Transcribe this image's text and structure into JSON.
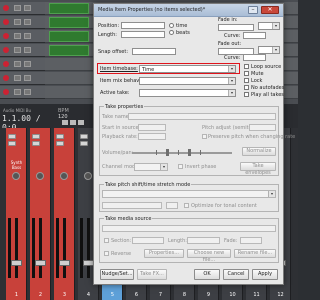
{
  "daw": {
    "transport_time": "1.1.00 / 0:0",
    "transport_label": "Audio MIDI Bu",
    "bpm_label": "BPM",
    "bpm_value": "120",
    "track_name": "Synth Bass",
    "strip_numbers": [
      "1",
      "2",
      "3",
      "4",
      "5",
      "6",
      "7",
      "8",
      "9",
      "10",
      "11",
      "12"
    ],
    "strip_colors": [
      "#c8413a",
      "#c8413a",
      "#c8413a",
      "#3d3f44",
      "#5ea0d8",
      "#3d3f44",
      "#3d3f44",
      "#3d3f44",
      "#3d3f44",
      "#3d3f44",
      "#3d3f44",
      "#3d3f44"
    ]
  },
  "dialog": {
    "title": "Media Item Properties (no items selected)*",
    "position_label": "Position:",
    "length_label": "Length:",
    "snap_offset_label": "Snap offset:",
    "time_base_beats": "beats",
    "time_base_time": "time",
    "fade_in_label": "Fade in:",
    "fade_out_label": "Fade out:",
    "curve_label": "Curve:",
    "item_timebase_label": "Item timebase:",
    "item_timebase_value": "Time",
    "item_mix_label": "Item mix behavior:",
    "active_take_label": "Active take:",
    "loop_source": "Loop source",
    "mute": "Mute",
    "lock": "Lock",
    "no_autofades": "No autofades",
    "play_all_takes": "Play all takes",
    "take_properties_title": "Take properties",
    "take_name_label": "Take name:",
    "start_in_source_label": "Start in source:",
    "playback_rate_label": "Playback rate:",
    "pitch_adjust_label": "Pitch adjust (semitones):",
    "preserve_pitch_label": "Preserve pitch when changing rate",
    "volume_pan_label": "Volume/pan:",
    "normalize_btn": "Normalize",
    "channel_mode_label": "Channel mode:",
    "invert_phase_label": "Invert phase",
    "take_envelopes_btn": "Take envelopes",
    "pitch_shift_title": "Take pitch shift/time stretch mode",
    "optimize_label": "Optimize for tonal content",
    "media_source_title": "Take media source",
    "section_label": "Section:",
    "length_small_label": "Length:",
    "fade_small_label": "Fade:",
    "reverse_label": "Reverse",
    "properties_btn": "Properties...",
    "choose_new_file_btn": "Choose new file...",
    "rename_file_btn": "Rename file...",
    "nudge_set_btn": "Nudge/Set...",
    "take_fx_btn": "Take FX...",
    "ok_btn": "OK",
    "cancel_btn": "Cancel",
    "apply_btn": "Apply"
  }
}
